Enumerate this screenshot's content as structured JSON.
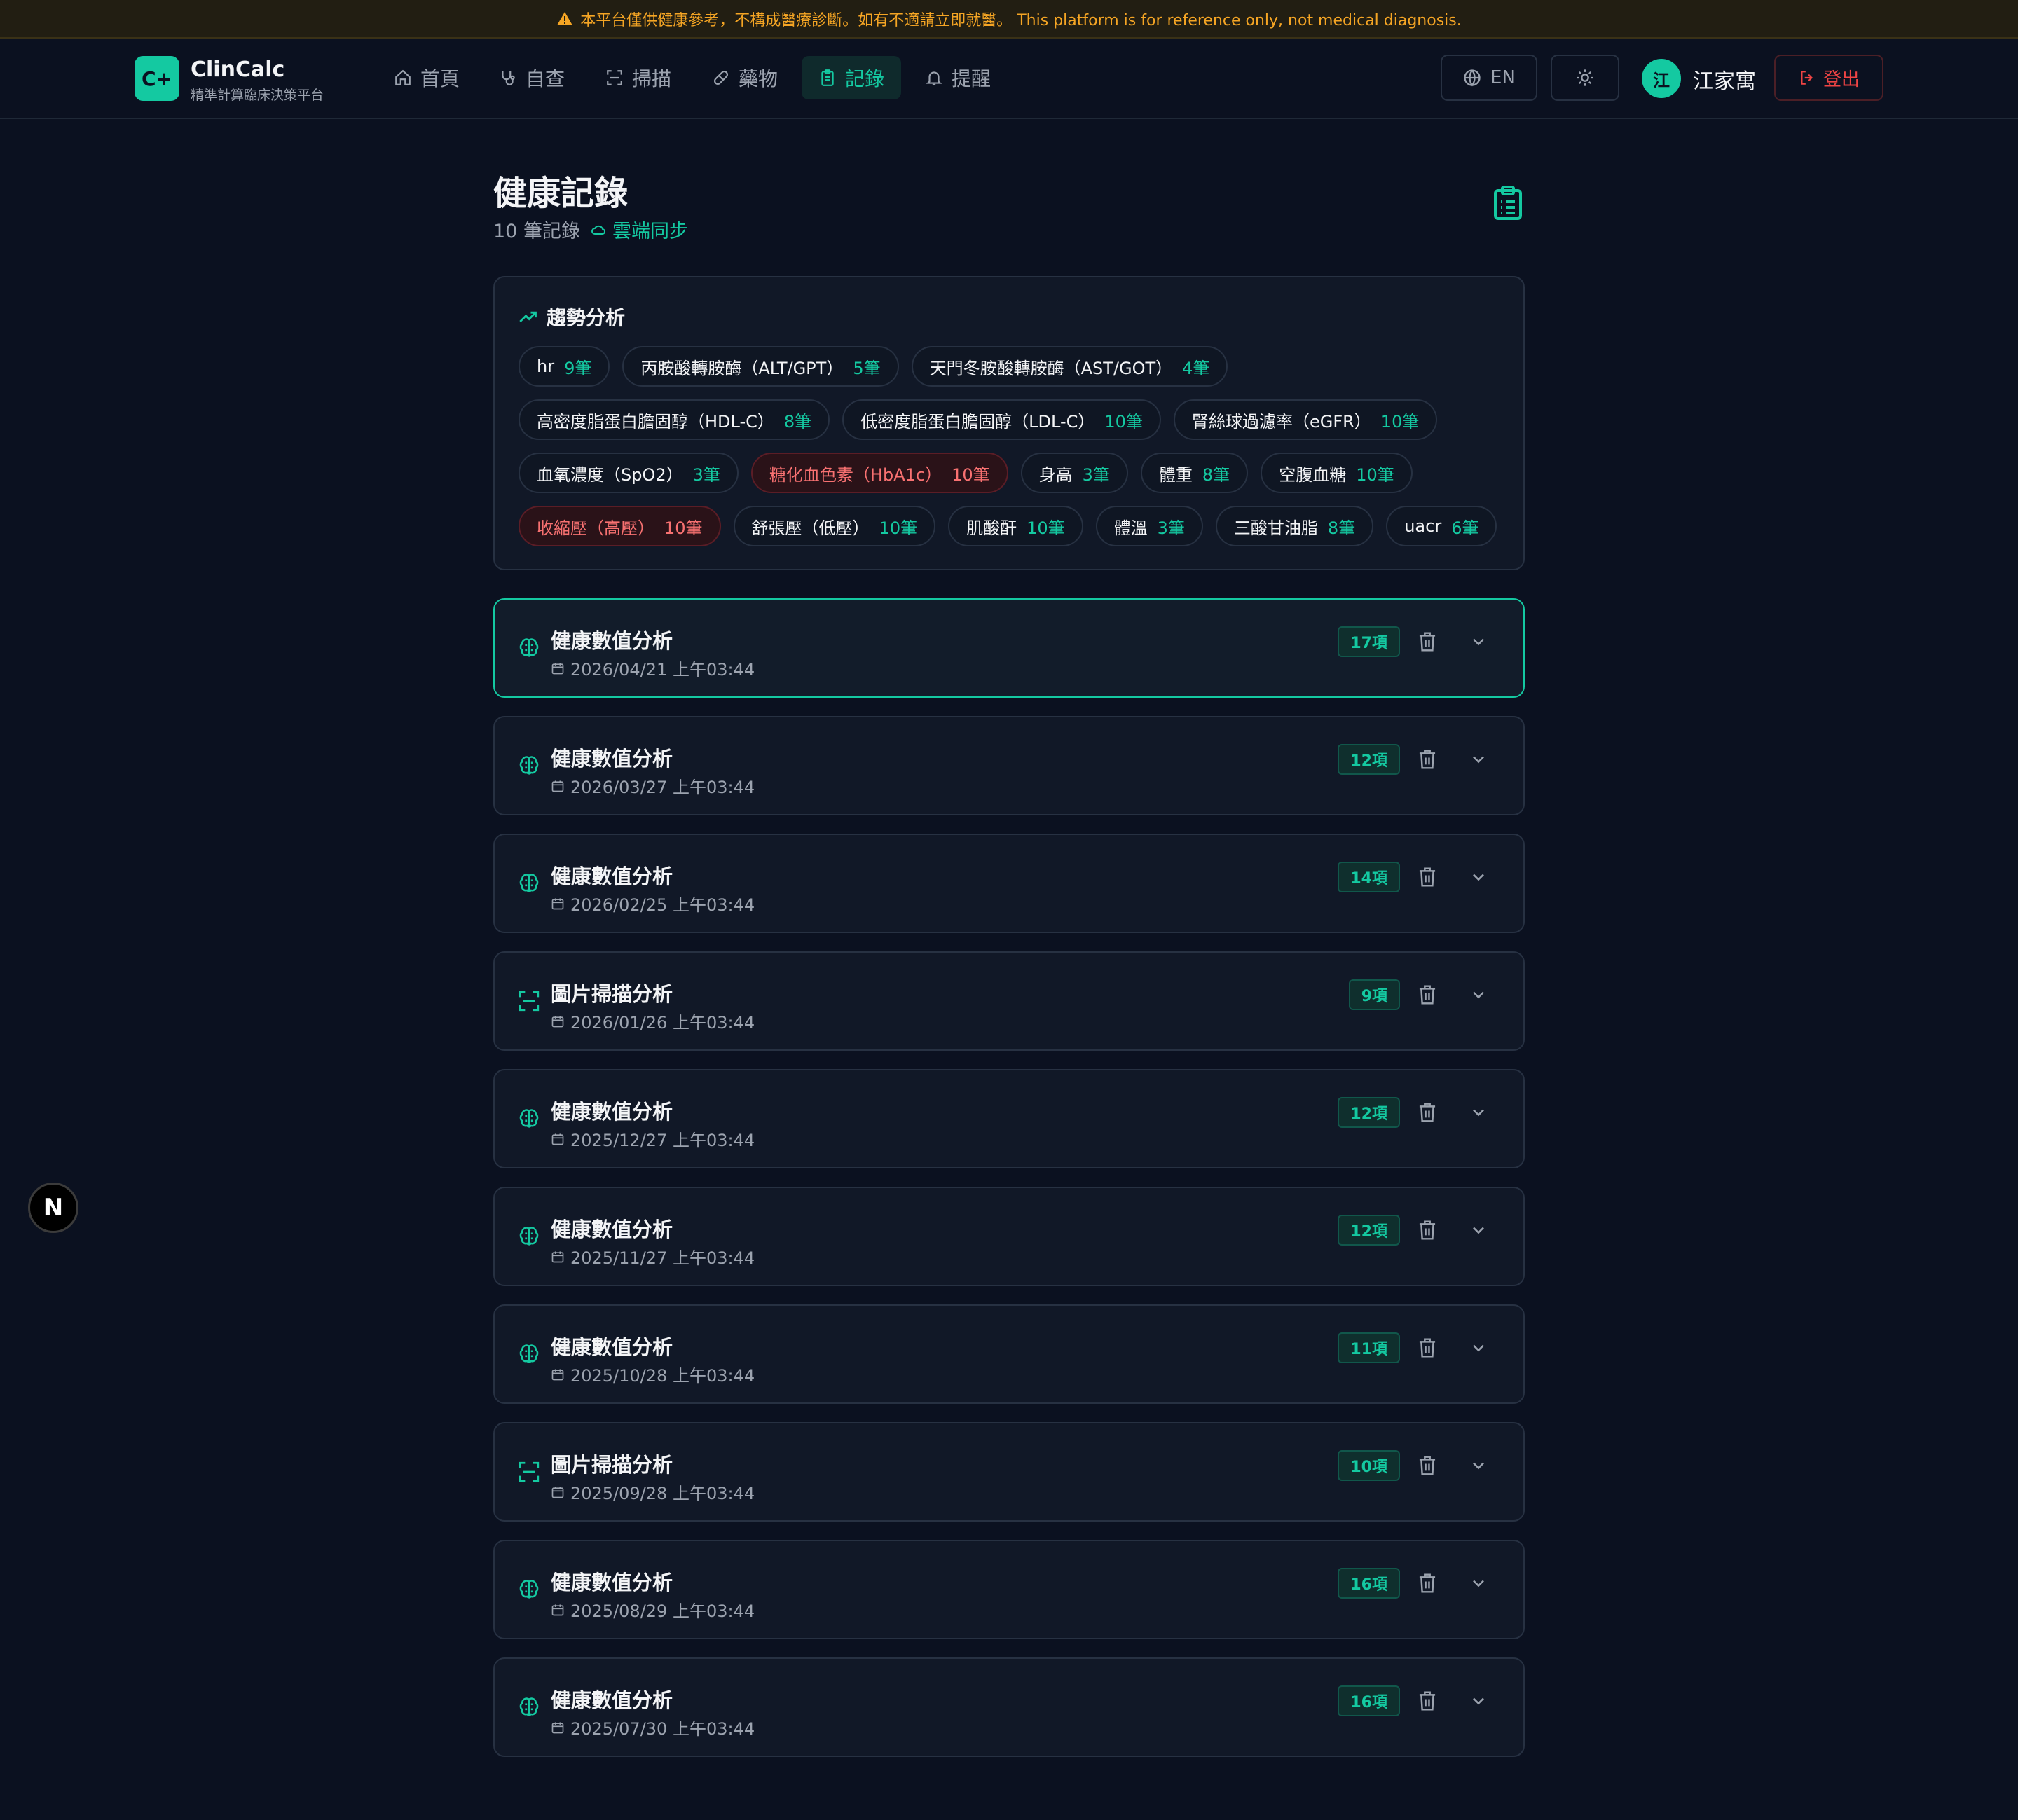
{
  "banner": {
    "text": "本平台僅供健康參考，不構成醫療診斷。如有不適請立即就醫。 This platform is for reference only, not medical diagnosis."
  },
  "brand": {
    "logo": "C+",
    "name": "ClinCalc",
    "subtitle": "精準計算臨床決策平台"
  },
  "nav": {
    "items": [
      {
        "label": "首頁",
        "icon": "home-icon",
        "active": false
      },
      {
        "label": "自查",
        "icon": "stethoscope-icon",
        "active": false
      },
      {
        "label": "掃描",
        "icon": "scan-icon",
        "active": false
      },
      {
        "label": "藥物",
        "icon": "pill-icon",
        "active": false
      },
      {
        "label": "記錄",
        "icon": "clipboard-icon",
        "active": true
      },
      {
        "label": "提醒",
        "icon": "bell-icon",
        "active": false
      }
    ],
    "lang_label": "EN",
    "theme_icon": "sun-icon",
    "avatar_initial": "江",
    "username": "江家寓",
    "logout_label": "登出"
  },
  "page": {
    "title": "健康記錄",
    "record_count": "10 筆記錄",
    "sync_label": "雲端同步"
  },
  "trend": {
    "title": "趨勢分析",
    "rows": [
      [
        {
          "label": "hr",
          "count": "9筆",
          "alert": false
        },
        {
          "label": "丙胺酸轉胺酶（ALT/GPT）",
          "count": "5筆",
          "alert": false
        },
        {
          "label": "天門冬胺酸轉胺酶（AST/GOT）",
          "count": "4筆",
          "alert": false
        }
      ],
      [
        {
          "label": "高密度脂蛋白膽固醇（HDL-C）",
          "count": "8筆",
          "alert": false
        },
        {
          "label": "低密度脂蛋白膽固醇（LDL-C）",
          "count": "10筆",
          "alert": false
        },
        {
          "label": "腎絲球過濾率（eGFR）",
          "count": "10筆",
          "alert": false
        }
      ],
      [
        {
          "label": "血氧濃度（SpO2）",
          "count": "3筆",
          "alert": false
        },
        {
          "label": "糖化血色素（HbA1c）",
          "count": "10筆",
          "alert": true
        },
        {
          "label": "身高",
          "count": "3筆",
          "alert": false
        },
        {
          "label": "體重",
          "count": "8筆",
          "alert": false
        },
        {
          "label": "空腹血糖",
          "count": "10筆",
          "alert": false
        }
      ],
      [
        {
          "label": "收縮壓（高壓）",
          "count": "10筆",
          "alert": true
        },
        {
          "label": "舒張壓（低壓）",
          "count": "10筆",
          "alert": false
        },
        {
          "label": "肌酸酐",
          "count": "10筆",
          "alert": false
        },
        {
          "label": "體溫",
          "count": "3筆",
          "alert": false
        },
        {
          "label": "三酸甘油脂",
          "count": "8筆",
          "alert": false
        },
        {
          "label": "uacr",
          "count": "6筆",
          "alert": false
        }
      ]
    ]
  },
  "records": [
    {
      "title": "健康數值分析",
      "date": "2026/04/21 上午03:44",
      "items": "17項",
      "icon": "brain-icon",
      "highlighted": true
    },
    {
      "title": "健康數值分析",
      "date": "2026/03/27 上午03:44",
      "items": "12項",
      "icon": "brain-icon",
      "highlighted": false
    },
    {
      "title": "健康數值分析",
      "date": "2026/02/25 上午03:44",
      "items": "14項",
      "icon": "brain-icon",
      "highlighted": false
    },
    {
      "title": "圖片掃描分析",
      "date": "2026/01/26 上午03:44",
      "items": "9項",
      "icon": "scan-icon",
      "highlighted": false
    },
    {
      "title": "健康數值分析",
      "date": "2025/12/27 上午03:44",
      "items": "12項",
      "icon": "brain-icon",
      "highlighted": false
    },
    {
      "title": "健康數值分析",
      "date": "2025/11/27 上午03:44",
      "items": "12項",
      "icon": "brain-icon",
      "highlighted": false
    },
    {
      "title": "健康數值分析",
      "date": "2025/10/28 上午03:44",
      "items": "11項",
      "icon": "brain-icon",
      "highlighted": false
    },
    {
      "title": "圖片掃描分析",
      "date": "2025/09/28 上午03:44",
      "items": "10項",
      "icon": "scan-icon",
      "highlighted": false
    },
    {
      "title": "健康數值分析",
      "date": "2025/08/29 上午03:44",
      "items": "16項",
      "icon": "brain-icon",
      "highlighted": false
    },
    {
      "title": "健康數值分析",
      "date": "2025/07/30 上午03:44",
      "items": "16項",
      "icon": "brain-icon",
      "highlighted": false
    }
  ],
  "floating": {
    "label": "N"
  },
  "colors": {
    "accent": "#14c9a1",
    "alert": "#f87171",
    "warning": "#f5a524",
    "background": "#0b1120"
  }
}
